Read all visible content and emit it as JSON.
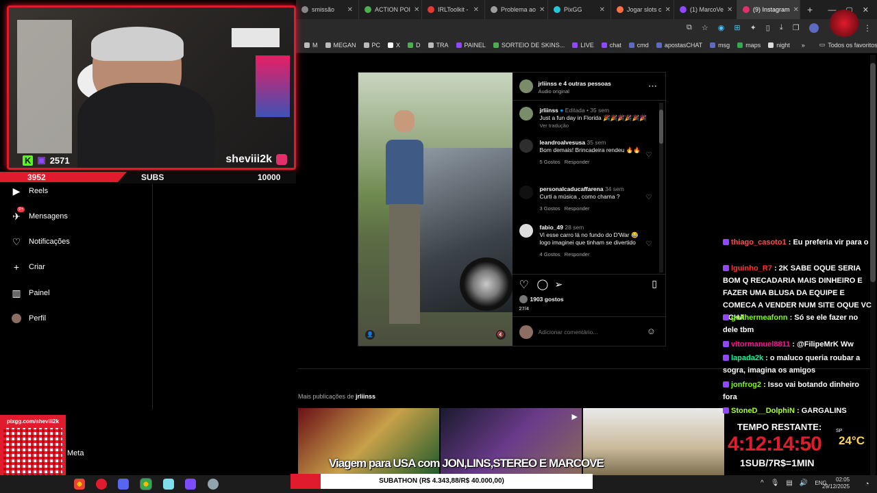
{
  "browser": {
    "tabs": [
      {
        "label": "smissão",
        "color": "#888888"
      },
      {
        "label": "ACTION POI",
        "color": "#4caf50"
      },
      {
        "label": "IRLToolkit -",
        "color": "#e53935"
      },
      {
        "label": "Problema ao",
        "color": "#9e9e9e"
      },
      {
        "label": "PixGG",
        "color": "#26c6da"
      },
      {
        "label": "Jogar slots c",
        "color": "#ff7043"
      },
      {
        "label": "(1) MarcoVe",
        "color": "#9146ff"
      },
      {
        "label": "(9) Instagram",
        "color": "#e1306c",
        "active": true
      }
    ],
    "new_tab": "+",
    "bookmarks": [
      "M",
      "MEGAN",
      "PC",
      "X",
      "D",
      "TRA",
      "PAINEL",
      "SORTEIO DE SKINS...",
      "LIVE",
      "chat",
      "cmd",
      "apostasCHAT",
      "msg",
      "maps",
      "night"
    ],
    "more_bookmarks": "»",
    "all_favorites": "Todos os favoritos"
  },
  "stream": {
    "kick_count": "2571",
    "channel": "sheviii2k",
    "subs_current": "3952",
    "subs_label": "SUBS",
    "subs_goal": "10000",
    "subs_progress": 0.395,
    "qr_url": "pixgg.com/sheviii2k",
    "meta_label": "Meta",
    "timer_label": "TEMPO RESTANTE:",
    "timer_value": "4:12:14:50",
    "temp_label": "SP",
    "temp_value": "24°C",
    "rate": "1SUB/7R$=1MIN",
    "caption": "Viagem para USA com JON,LINS,STEREO E MARCOVE",
    "subathon": "SUBATHON (R$ 4.343,88/R$ 40.000,00)",
    "subathon_progress": 0.109
  },
  "sidebar": {
    "items": [
      {
        "label": "Reels",
        "icon": "▶"
      },
      {
        "label": "Mensagens",
        "icon": "✈",
        "badge": "9+"
      },
      {
        "label": "Notificações",
        "icon": "♡"
      },
      {
        "label": "Criar",
        "icon": "+"
      },
      {
        "label": "Painel",
        "icon": "▥"
      },
      {
        "label": "Perfil",
        "icon": "●"
      }
    ]
  },
  "post": {
    "header_user": "jrliinss e 4 outras pessoas",
    "audio": "Áudio original",
    "more": "⋯",
    "caption_user": "jrliinss",
    "caption_meta": "Editada • 35 sem",
    "caption_text": "Just a fun day in Florida 🎉🎉🎉🎉🎉🎉",
    "see_translation": "Ver tradução",
    "comments": [
      {
        "user": "leandroalvesusa",
        "time": "35 sem",
        "text": "Bom demais! Brincadeira rendeu 🔥🔥",
        "likes": "5 Gostos",
        "reply": "Responder"
      },
      {
        "user": "personalcaducaffarena",
        "time": "34 sem",
        "text": "Curti a música , como chama ?",
        "likes": "3 Gostos",
        "reply": "Responder"
      },
      {
        "user": "fabio_49",
        "time": "28 sem",
        "text": "Vi esse carro lá no fundo do D'War 😂 logo imaginei que tinham se divertido",
        "likes": "4 Gostos",
        "reply": "Responder"
      }
    ],
    "likes": "1903 gostos",
    "date": "27/4",
    "comment_placeholder": "Adicionar comentário..."
  },
  "more_posts": {
    "prefix": "Mais publicações de ",
    "user": "jrliinss"
  },
  "chat": [
    {
      "user": "thiago_casoto1",
      "color": "#ff4d4d",
      "text": ": Eu preferia vir para o"
    },
    {
      "user": "lguinho_R7",
      "color": "#ff3030",
      "text": ": 2K SABE OQUE SERIA BOM Q RECADARIA MAIS DINHEIRO E FAZER UMA BLUSA DA EQUIPE E COMECA A VENDER NUM SITE OQUE VC ACHA"
    },
    {
      "user": "guilhermeafonn",
      "color": "#7cfc00",
      "text": ": Só se ele fazer no dele tbm"
    },
    {
      "user": "vitormanuel8811",
      "color": "#ff1493",
      "text": ": @FilipeMrK Ww"
    },
    {
      "user": "lapada2k",
      "color": "#00fa9a",
      "text": ": o maluco queria roubar a sogra, imagina os amigos"
    },
    {
      "user": "jonfrog2",
      "color": "#7cfc00",
      "text": ": Isso vai botando dinheiro fora"
    },
    {
      "user": "StoneD__DolphiN",
      "color": "#adff2f",
      "text": ": GARGALINS"
    }
  ],
  "taskbar": {
    "lang": "ENG",
    "time": "02:05",
    "date": "29/12/2025"
  }
}
